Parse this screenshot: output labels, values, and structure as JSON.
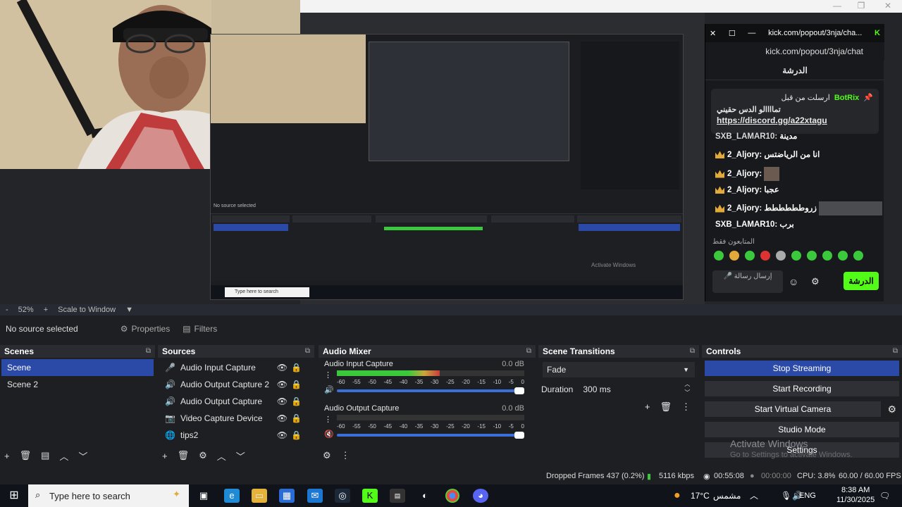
{
  "preview": {
    "window_buttons": [
      "—",
      "❐",
      "✕"
    ],
    "nested_labels": {
      "no_source": "No source selected",
      "properties": "Properties",
      "filters": "Filters",
      "zoom": "52%",
      "scale": "Scale to Window",
      "dropped": "Dropped Frames 437 (0.2%)",
      "kbps": "5116 kbps",
      "time": "00:55:08",
      "cpu": "CPU: 3.8%",
      "fps": "60.00 / 60.00 FPS",
      "activate": "Activate Windows",
      "search": "Type here to search"
    }
  },
  "chat": {
    "window_title": "kick.com/popout/3nja/cha...",
    "url": "kick.com/popout/3nja/chat",
    "title": "الدرشة",
    "pinned_by": "ارسلت من قبل",
    "pinned_user": "BotRix",
    "pinned_text": "تماااالو الدس حقيني",
    "pinned_link": "https://discord.gg/a22xtagu",
    "lines": [
      {
        "user": "SXB_LAMAR10:",
        "text": "مدينة",
        "crown": false
      },
      {
        "user": "2_Aljory:",
        "text": "انا من الرياضتس",
        "crown": true
      },
      {
        "user": "2_Aljory:",
        "text": "",
        "crown": true
      },
      {
        "user": "2_Aljory:",
        "text": "عجبا",
        "crown": true
      },
      {
        "user": "2_Aljory:",
        "text": "زروطططططط",
        "crown": true
      },
      {
        "user": "SXB_LAMAR10:",
        "text": "برب",
        "crown": false
      }
    ],
    "followers_only": "المتابعون فقط",
    "input_placeholder": "إرسال رسالة",
    "send": "الدرشة"
  },
  "zoombar": {
    "minus": "-",
    "zoom": "52%",
    "plus": "+",
    "scale": "Scale to Window"
  },
  "context": {
    "no_source": "No source selected",
    "properties": "Properties",
    "filters": "Filters"
  },
  "scenes": {
    "title": "Scenes",
    "items": [
      "Scene",
      "Scene 2"
    ]
  },
  "sources": {
    "title": "Sources",
    "items": [
      {
        "label": "Audio Input Capture",
        "icon": "🎤"
      },
      {
        "label": "Audio Output Capture 2",
        "icon": "🔊"
      },
      {
        "label": "Audio Output Capture",
        "icon": "🔊"
      },
      {
        "label": "Video Capture Device",
        "icon": "📷"
      },
      {
        "label": "tips2",
        "icon": "🌐"
      }
    ]
  },
  "mixer": {
    "title": "Audio Mixer",
    "channels": [
      {
        "name": "Audio Input Capture",
        "db": "0.0 dB",
        "level": 0.55
      },
      {
        "name": "Audio Output Capture",
        "db": "0.0 dB",
        "level": 0.0
      }
    ],
    "scale": [
      "-60",
      "-55",
      "-50",
      "-45",
      "-40",
      "-35",
      "-30",
      "-25",
      "-20",
      "-15",
      "-10",
      "-5",
      "0"
    ]
  },
  "transitions": {
    "title": "Scene Transitions",
    "selected": "Fade",
    "duration_label": "Duration",
    "duration_value": "300 ms"
  },
  "controls": {
    "title": "Controls",
    "stop_streaming": "Stop Streaming",
    "start_recording": "Start Recording",
    "start_virtual_camera": "Start Virtual Camera",
    "studio_mode": "Studio Mode",
    "settings": "Settings"
  },
  "activate": {
    "line1": "Activate Windows",
    "line2": "Go to Settings to activate Windows."
  },
  "status": {
    "dropped": "Dropped Frames 437 (0.2%)",
    "kbps": "5116 kbps",
    "live_time": "00:55:08",
    "rec_time": "00:00:00",
    "cpu": "CPU: 3.8%",
    "fps": "60.00 / 60.00 FPS"
  },
  "taskbar": {
    "search": "Type here to search",
    "weather": "17°C",
    "weather_text": "مشمس",
    "lang": "ENG",
    "time": "8:38 AM",
    "date": "11/30/2025"
  },
  "colors": {
    "accent": "#2b4aa8",
    "kick_green": "#53fc18",
    "meter_green": "#3cc83c"
  }
}
